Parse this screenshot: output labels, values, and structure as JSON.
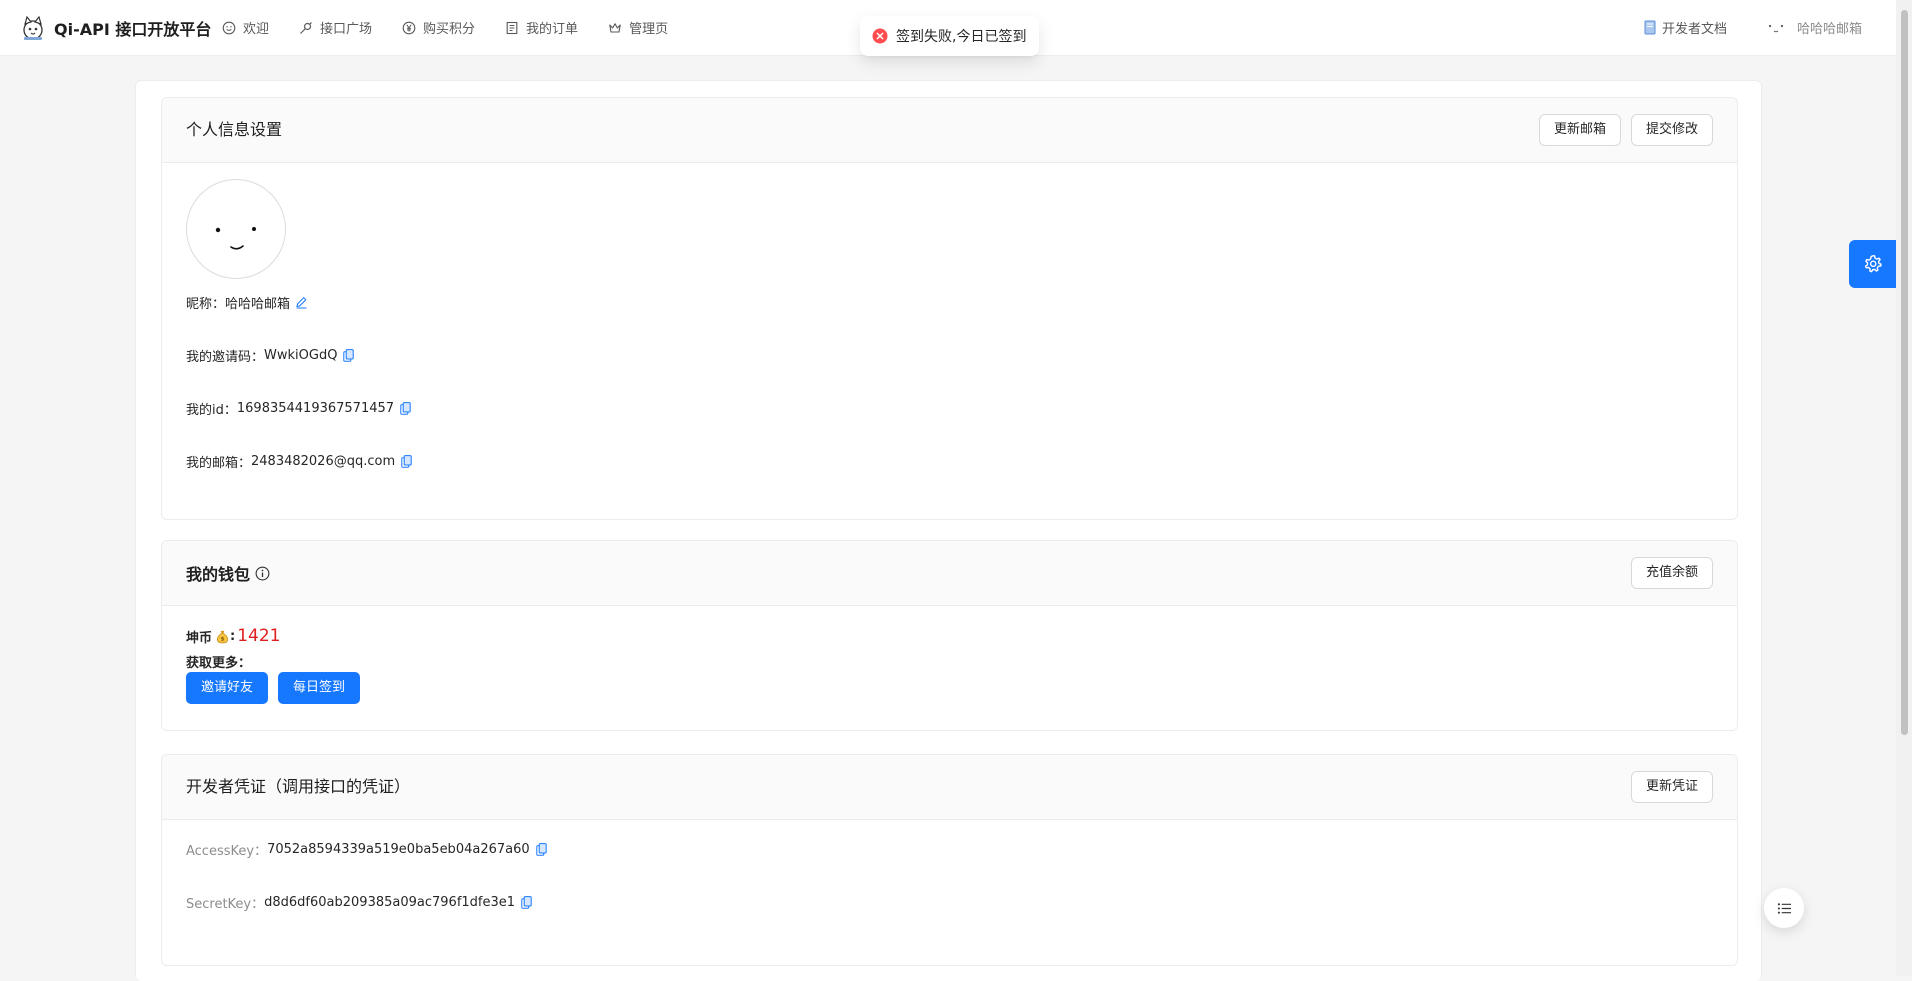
{
  "app": {
    "title": "Qi-API 接口开放平台",
    "nav": [
      {
        "label": "欢迎",
        "icon": "smile-icon"
      },
      {
        "label": "接口广场",
        "icon": "api-icon"
      },
      {
        "label": "购买积分",
        "icon": "yen-icon"
      },
      {
        "label": "我的订单",
        "icon": "order-icon"
      },
      {
        "label": "管理页",
        "icon": "crown-icon"
      }
    ],
    "docs_label": "开发者文档",
    "username": "哈哈哈邮箱"
  },
  "toast": {
    "type": "error",
    "message": "签到失败,今日已签到"
  },
  "profile": {
    "title": "个人信息设置",
    "update_email_button": "更新邮箱",
    "submit_button": "提交修改",
    "nickname_label": "昵称：",
    "nickname": "哈哈哈邮箱",
    "invite_code_label": "我的邀请码：",
    "invite_code": "WwkiOGdQ",
    "id_label": "我的id：",
    "id": "1698354419367571457",
    "email_label": "我的邮箱：",
    "email": "2483482026@qq.com"
  },
  "wallet": {
    "title": "我的钱包",
    "recharge_button": "充值余额",
    "coin_label": "坤币",
    "coin_value": "1421",
    "more_label": "获取更多：",
    "invite_button": "邀请好友",
    "signin_button": "每日签到"
  },
  "credentials": {
    "title": "开发者凭证（调用接口的凭证）",
    "update_button": "更新凭证",
    "access_key_label": "AccessKey：",
    "access_key": "7052a8594339a519e0ba5eb04a267a60",
    "secret_key_label": "SecretKey：",
    "secret_key": "d8d6df60ab209385a09ac796f1dfe3e1"
  },
  "colors": {
    "primary": "#1677ff",
    "error": "#ff4d4f",
    "coin": "#e02020"
  }
}
